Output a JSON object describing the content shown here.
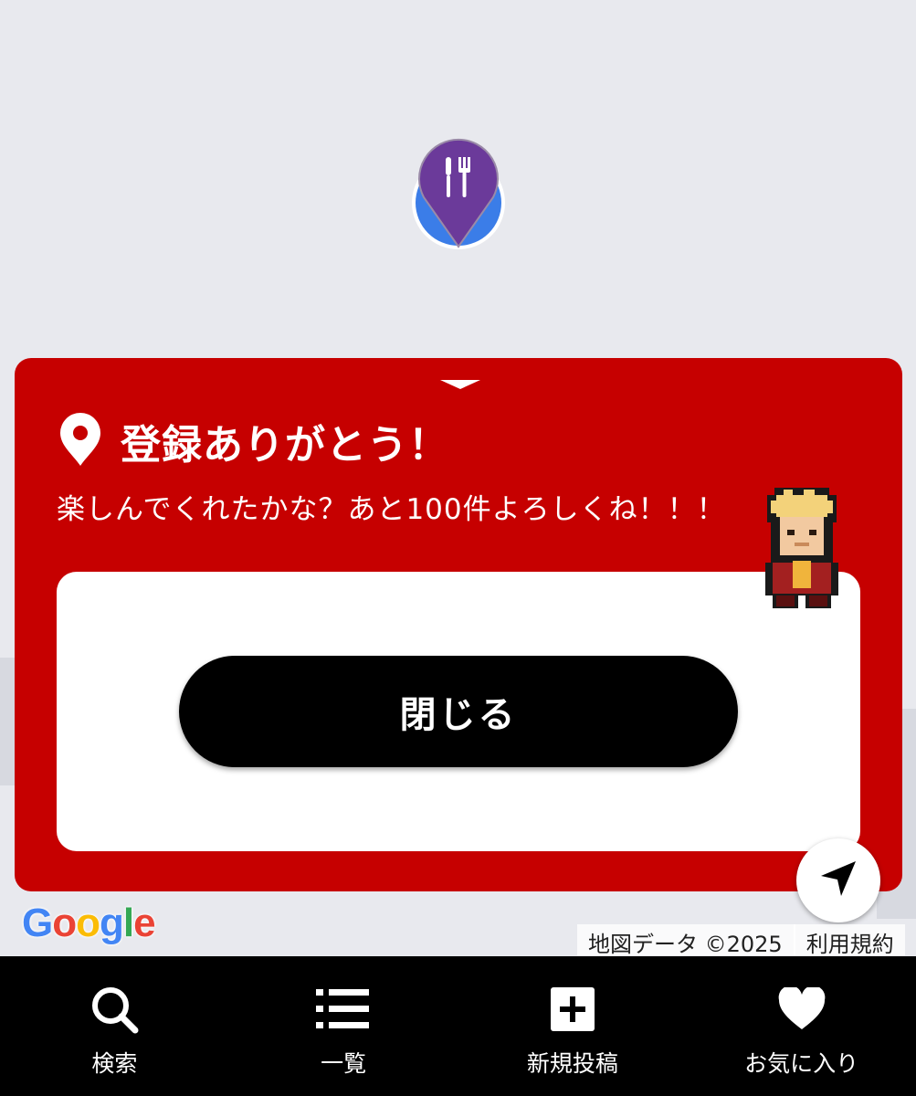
{
  "map": {
    "pin_icon": "fork-knife-icon",
    "pin_color": "#6b3a9a",
    "pin_base_color": "#3b7de8",
    "google_logo": "Google",
    "attribution": {
      "map_data": "地図データ ©2025",
      "terms": "利用規約"
    }
  },
  "popup": {
    "background": "#c60000",
    "title": "登録ありがとう！",
    "message": "楽しんでくれたかな？あと100件よろしくね！！！",
    "close_label": "閉じる",
    "icon": "location-pin-icon",
    "mascot": "pixel-character-avatar"
  },
  "locate_button": {
    "icon": "navigation-arrow-icon"
  },
  "tabbar": {
    "items": [
      {
        "label": "検索",
        "icon": "search-icon"
      },
      {
        "label": "一覧",
        "icon": "list-icon"
      },
      {
        "label": "新規投稿",
        "icon": "add-square-icon"
      },
      {
        "label": "お気に入り",
        "icon": "heart-icon"
      }
    ]
  }
}
